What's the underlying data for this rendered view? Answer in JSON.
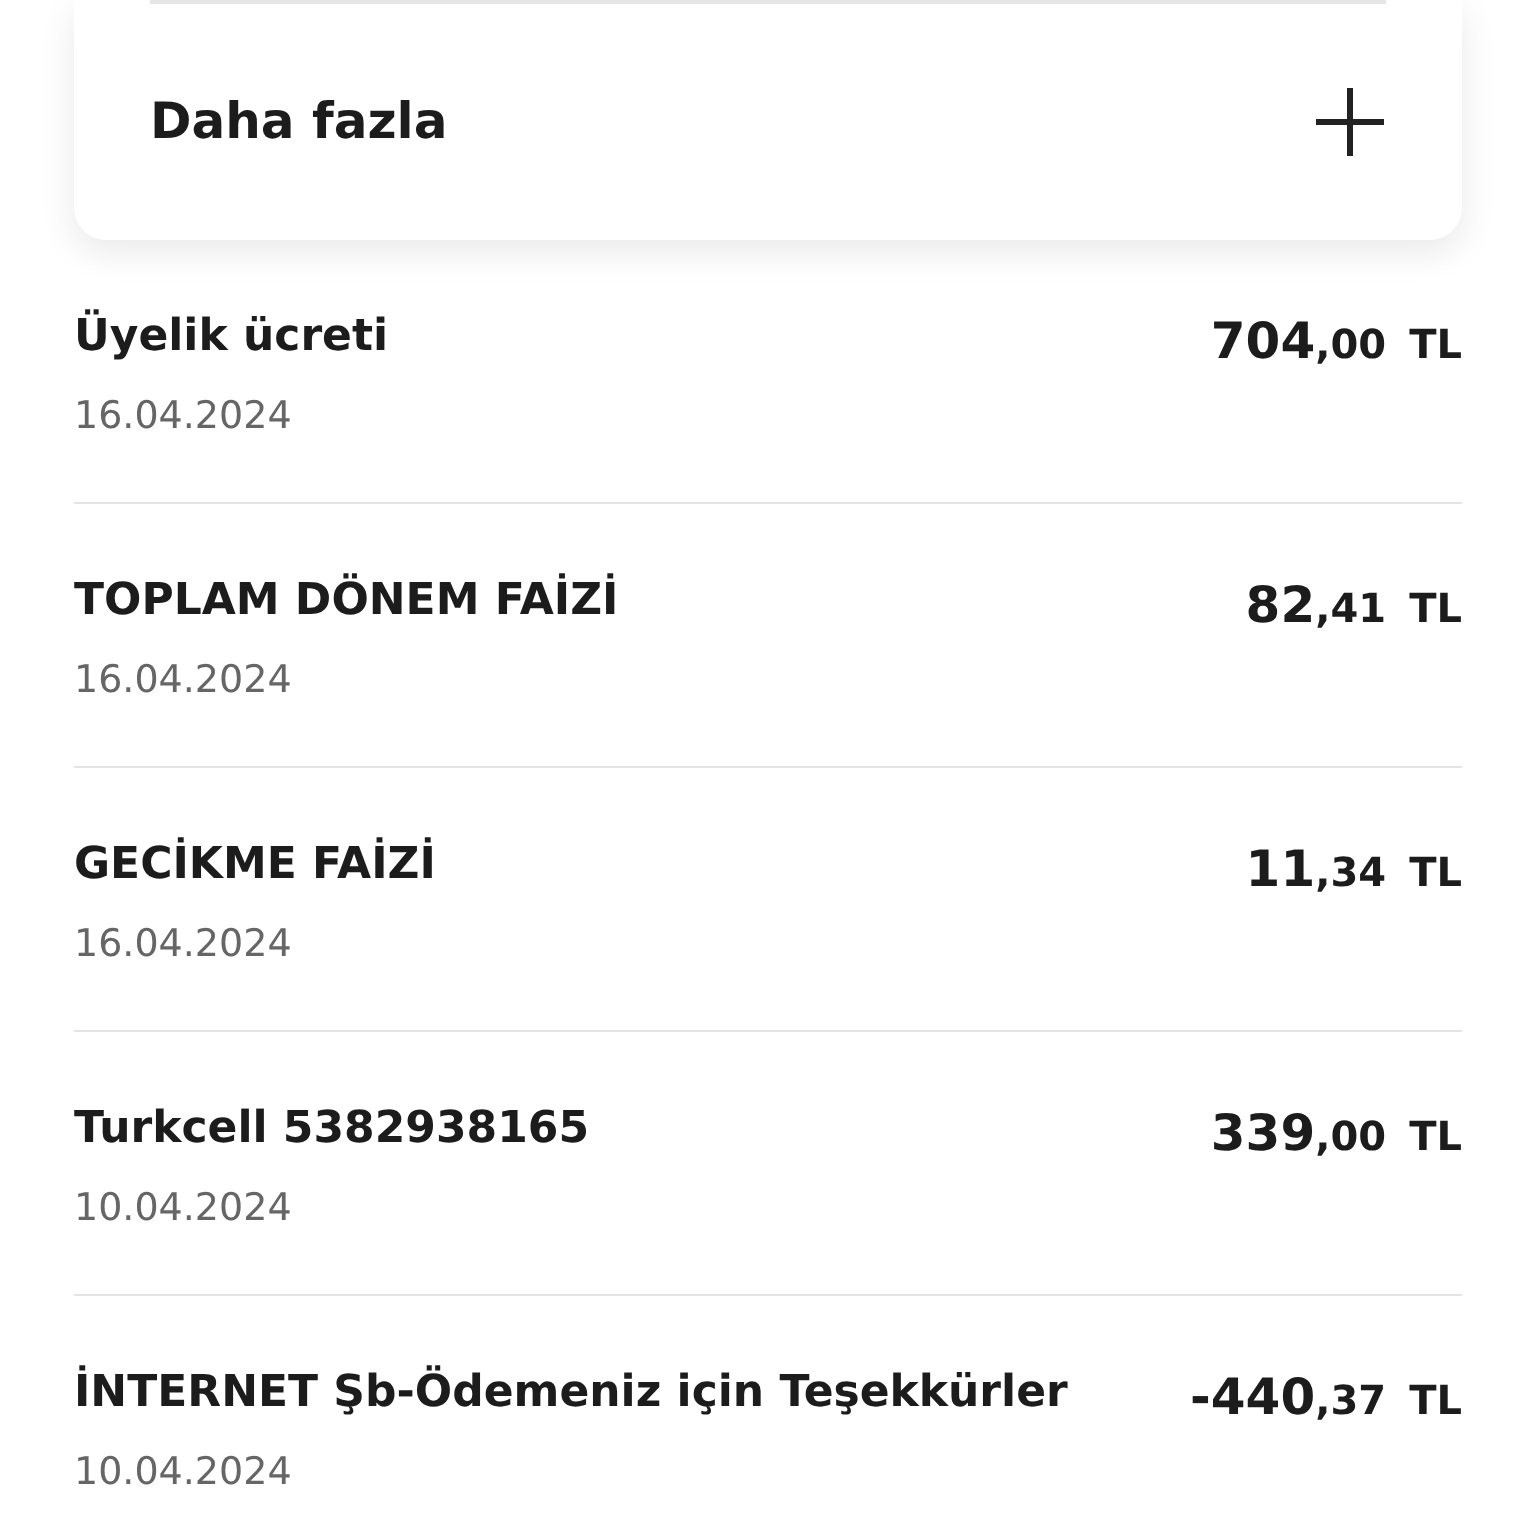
{
  "more_panel": {
    "label": "Daha fazla",
    "expanded": false
  },
  "transactions": [
    {
      "title": "Üyelik ücreti",
      "date": "16.04.2024",
      "amount": {
        "whole": "704",
        "fraction": ",00",
        "currency": "TL"
      }
    },
    {
      "title": "TOPLAM DÖNEM FAİZİ",
      "date": "16.04.2024",
      "amount": {
        "whole": "82",
        "fraction": ",41",
        "currency": "TL"
      }
    },
    {
      "title": "GECİKME FAİZİ",
      "date": "16.04.2024",
      "amount": {
        "whole": "11",
        "fraction": ",34",
        "currency": "TL"
      }
    },
    {
      "title": "Turkcell 5382938165",
      "date": "10.04.2024",
      "amount": {
        "whole": "339",
        "fraction": ",00",
        "currency": "TL"
      }
    },
    {
      "title": "İNTERNET Şb-Ödemeniz için Teşekkürler",
      "date": "10.04.2024",
      "amount": {
        "whole": "-440",
        "fraction": ",37",
        "currency": "TL"
      }
    }
  ]
}
